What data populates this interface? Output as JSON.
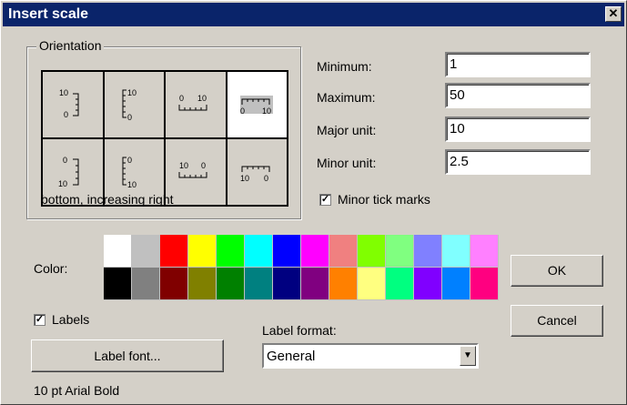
{
  "window": {
    "title": "Insert scale",
    "close_label": "✕"
  },
  "orientation": {
    "legend": "Orientation",
    "caption": "bottom, increasing right",
    "options": [
      {
        "name": "vertical-left-increasing-up",
        "labels": [
          "10",
          "0"
        ]
      },
      {
        "name": "vertical-right-increasing-up",
        "labels": [
          "10",
          "0"
        ]
      },
      {
        "name": "top-increasing-right",
        "labels": [
          "0",
          "10"
        ]
      },
      {
        "name": "bottom-increasing-right",
        "labels": [
          "0",
          "10"
        ],
        "selected": true
      },
      {
        "name": "vertical-left-increasing-down",
        "labels": [
          "0",
          "10"
        ]
      },
      {
        "name": "vertical-right-increasing-down",
        "labels": [
          "0",
          "10"
        ]
      },
      {
        "name": "top-increasing-left",
        "labels": [
          "10",
          "0"
        ]
      },
      {
        "name": "bottom-increasing-left",
        "labels": [
          "10",
          "0"
        ]
      }
    ]
  },
  "fields": {
    "minimum": {
      "label": "Minimum:",
      "value": "1"
    },
    "maximum": {
      "label": "Maximum:",
      "value": "50"
    },
    "major": {
      "label": "Major unit:",
      "value": "10"
    },
    "minor": {
      "label": "Minor unit:",
      "value": "2.5"
    }
  },
  "minor_ticks": {
    "label": "Minor tick marks",
    "checked": true
  },
  "color": {
    "label": "Color:",
    "swatches": [
      "#ffffff",
      "#c0c0c0",
      "#ff0000",
      "#ffff00",
      "#00ff00",
      "#00ffff",
      "#0000ff",
      "#ff00ff",
      "#f08080",
      "#80ff00",
      "#80ff80",
      "#8080ff",
      "#80ffff",
      "#ff80ff",
      "#000000",
      "#808080",
      "#800000",
      "#808000",
      "#008000",
      "#008080",
      "#000080",
      "#800080",
      "#ff8000",
      "#ffff80",
      "#00ff80",
      "#8000ff",
      "#0080ff",
      "#ff0080"
    ]
  },
  "labels_checkbox": {
    "label": "Labels",
    "checked": true
  },
  "label_font_button": "Label font...",
  "font_description": "10 pt Arial Bold",
  "label_format": {
    "label": "Label format:",
    "value": "General"
  },
  "buttons": {
    "ok": "OK",
    "cancel": "Cancel"
  }
}
